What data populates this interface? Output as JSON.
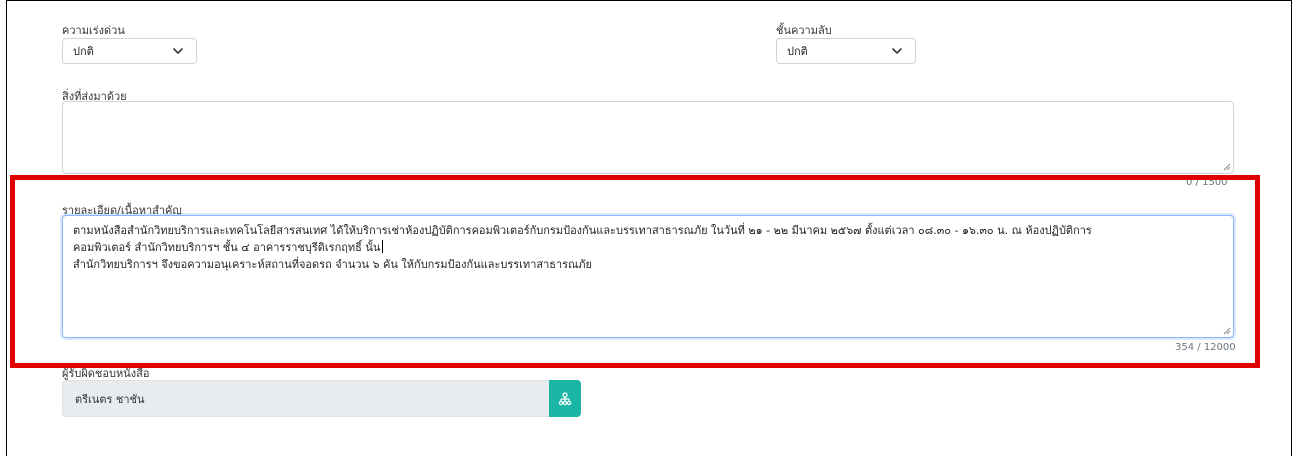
{
  "urgency": {
    "label": "ความเร่งด่วน",
    "selected": "ปกติ"
  },
  "secrecy": {
    "label": "ชั้นความลับ",
    "selected": "ปกติ"
  },
  "attachments": {
    "label": "สิ่งที่ส่งมาด้วย",
    "counter": "0 / 1500"
  },
  "details": {
    "label": "รายละเอียด/เนื้อหาสำคัญ",
    "lines": [
      "ตามหนังสือสำนักวิทยบริการและเทคโนโลยีสารสนเทศ ได้ให้บริการเช่าห้องปฏิบัติการคอมพิวเตอร์กับกรมป้องกันและบรรเทาสาธารณภัย ในวันที่ ๒๑ - ๒๒ มีนาคม ๒๕๖๗ ตั้งแต่เวลา ๐๘.๓๐ - ๑๖.๓๐ น. ณ ห้องปฏิบัติการ",
      "คอมพิวเตอร์ สำนักวิทยบริการฯ ชั้น ๔ อาคารราชบุรีดิเรกฤทธิ์ นั้น",
      "สำนักวิทยบริการฯ จึงขอความอนุเคราะห์สถานที่จอดรถ จำนวน ๖ คัน ให้กับกรมป้องกันและบรรเทาสาธารณภัย"
    ],
    "counter": "354 / 12000"
  },
  "signer": {
    "label": "ผู้รับผิดชอบหนังสือ",
    "value": "ตรีเนตร ชาชัน",
    "button_icon": "org-chart-icon"
  },
  "colors": {
    "highlight": "#e00000",
    "org_button": "#1bb5a5",
    "focus_border": "#86b7fe"
  }
}
